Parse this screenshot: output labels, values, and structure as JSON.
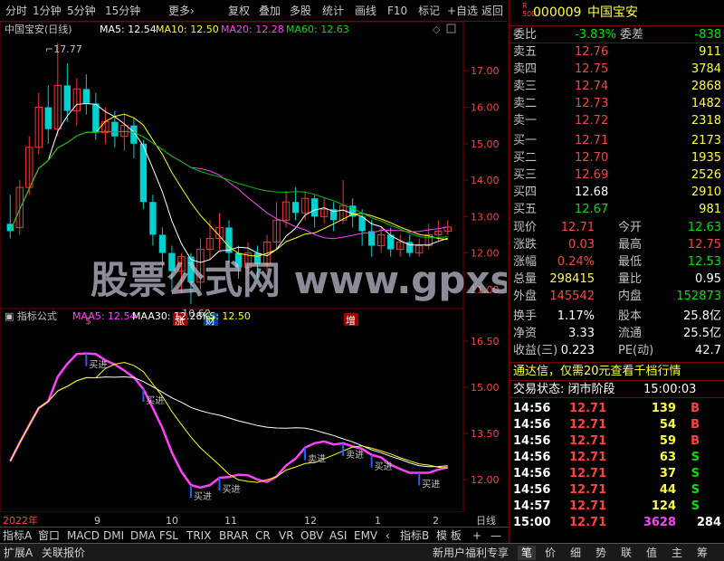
{
  "toolbar": {
    "left": [
      "分时",
      "1分钟",
      "5分钟",
      "15分钟",
      "更多›"
    ],
    "right": [
      "复权",
      "叠加",
      "多股",
      "统计",
      "画线",
      "F10",
      "标记",
      "+自选",
      "返回"
    ]
  },
  "chart_header": {
    "stock": "中国宝安(日线)",
    "ma5": "MA5: 12.54",
    "ma10": "MA10: 12.50",
    "ma20": "MA20: 12.28",
    "ma60": "MA60: 12.63"
  },
  "price_axis": [
    "17.00",
    "16.00",
    "15.00",
    "14.00",
    "13.00",
    "12.00",
    "11.00"
  ],
  "annotations": {
    "high": "17.77",
    "low": "10.60"
  },
  "event_marks": [
    "$",
    "涨",
    "财",
    "增"
  ],
  "watermark": "股票公式网 www.gpxs.com",
  "indicator": {
    "title": "指标公式",
    "maa5": "MAA5: 12.54",
    "maa30": "MAA30: 12.28",
    "ks": "KS: 12.50",
    "axis": [
      "16.50",
      "15.00",
      "13.50",
      "12.00"
    ],
    "buy_label": "买进",
    "sell_label": "卖进"
  },
  "dates": [
    "2022年",
    "9",
    "10",
    "11",
    "12",
    "1",
    "2"
  ],
  "period": "日线",
  "chart_data": {
    "type": "candlestick",
    "ylim": [
      10.5,
      17.9
    ],
    "ma_colors": {
      "ma5": "#ffffff",
      "ma10": "#ffff00",
      "ma20": "#ff40ff",
      "ma60": "#00c000"
    },
    "candles": [
      [
        12.8,
        12.6,
        13.6,
        12.4
      ],
      [
        12.7,
        13.8,
        14.0,
        12.5
      ],
      [
        13.8,
        14.9,
        15.2,
        13.6
      ],
      [
        14.9,
        16.0,
        16.4,
        14.7
      ],
      [
        16.0,
        15.4,
        16.6,
        15.0
      ],
      [
        15.4,
        16.6,
        17.77,
        15.2
      ],
      [
        16.6,
        15.9,
        17.2,
        15.6
      ],
      [
        15.9,
        16.5,
        16.8,
        15.5
      ],
      [
        16.5,
        16.1,
        16.9,
        15.8
      ],
      [
        16.1,
        15.3,
        16.4,
        15.1
      ],
      [
        15.3,
        15.6,
        16.0,
        15.0
      ],
      [
        15.6,
        15.2,
        15.9,
        14.9
      ],
      [
        15.2,
        15.5,
        15.8,
        14.8
      ],
      [
        15.5,
        15.0,
        15.7,
        14.6
      ],
      [
        15.0,
        13.4,
        15.1,
        13.2
      ],
      [
        13.4,
        12.5,
        13.6,
        12.2
      ],
      [
        12.5,
        12.0,
        12.7,
        11.6
      ],
      [
        12.0,
        11.5,
        12.2,
        11.0
      ],
      [
        11.5,
        11.9,
        12.0,
        10.9
      ],
      [
        11.9,
        11.2,
        12.0,
        10.6
      ],
      [
        11.2,
        12.1,
        12.4,
        11.0
      ],
      [
        12.1,
        12.4,
        12.9,
        11.8
      ],
      [
        12.4,
        12.7,
        13.1,
        12.1
      ],
      [
        12.7,
        12.0,
        12.9,
        11.7
      ],
      [
        12.0,
        11.6,
        12.2,
        11.3
      ],
      [
        11.6,
        12.0,
        12.3,
        11.4
      ],
      [
        12.0,
        11.7,
        12.2,
        11.3
      ],
      [
        11.7,
        12.3,
        12.5,
        11.5
      ],
      [
        12.3,
        12.9,
        13.4,
        12.1
      ],
      [
        12.9,
        13.4,
        13.7,
        12.7
      ],
      [
        13.4,
        13.1,
        13.8,
        12.9
      ],
      [
        13.1,
        13.5,
        13.7,
        12.9
      ],
      [
        13.5,
        13.0,
        13.6,
        12.7
      ],
      [
        13.0,
        13.2,
        13.5,
        12.8
      ],
      [
        13.2,
        12.9,
        13.4,
        12.6
      ],
      [
        12.9,
        13.3,
        14.0,
        12.8
      ],
      [
        13.3,
        13.0,
        13.5,
        12.7
      ],
      [
        13.0,
        12.6,
        13.2,
        12.2
      ],
      [
        12.6,
        12.2,
        12.9,
        11.9
      ],
      [
        12.2,
        12.5,
        12.7,
        12.0
      ],
      [
        12.5,
        12.1,
        12.7,
        11.9
      ],
      [
        12.1,
        12.3,
        12.5,
        11.9
      ],
      [
        12.3,
        12.0,
        12.5,
        11.9
      ],
      [
        12.0,
        12.2,
        12.4,
        11.9
      ],
      [
        12.2,
        12.5,
        12.8,
        12.1
      ],
      [
        12.5,
        12.6,
        12.9,
        12.3
      ],
      [
        12.6,
        12.71,
        12.9,
        12.5
      ]
    ]
  },
  "quote": {
    "code_badge": "R\n500",
    "code": "000009",
    "name": "中国宝安",
    "weibi_label": "委比",
    "weibi": "-3.83%",
    "weicha_label": "委差",
    "weicha": "-838",
    "asks": [
      {
        "label": "卖五",
        "price": "12.76",
        "vol": "911"
      },
      {
        "label": "卖四",
        "price": "12.75",
        "vol": "3784"
      },
      {
        "label": "卖三",
        "price": "12.74",
        "vol": "2868"
      },
      {
        "label": "卖二",
        "price": "12.73",
        "vol": "1482"
      },
      {
        "label": "卖一",
        "price": "12.72",
        "vol": "2318"
      }
    ],
    "bids": [
      {
        "label": "买一",
        "price": "12.71",
        "vol": "2173"
      },
      {
        "label": "买二",
        "price": "12.70",
        "vol": "1935"
      },
      {
        "label": "买三",
        "price": "12.69",
        "vol": "2526"
      },
      {
        "label": "买四",
        "price": "12.68",
        "vol": "2910"
      },
      {
        "label": "买五",
        "price": "12.67",
        "vol": "981"
      }
    ],
    "stats": [
      {
        "l1": "现价",
        "v1": "12.71",
        "l2": "今开",
        "v2": "12.63"
      },
      {
        "l1": "涨跌",
        "v1": "0.03",
        "l2": "最高",
        "v2": "12.75"
      },
      {
        "l1": "涨幅",
        "v1": "0.24%",
        "l2": "最低",
        "v2": "12.53"
      },
      {
        "l1": "总量",
        "v1": "298415",
        "l2": "量比",
        "v2": "0.95"
      },
      {
        "l1": "外盘",
        "v1": "145542",
        "l2": "内盘",
        "v2": "152873"
      }
    ],
    "stats2": [
      {
        "l1": "换手",
        "v1": "1.17%",
        "l2": "股本",
        "v2": "25.8亿"
      },
      {
        "l1": "净资",
        "v1": "3.33",
        "l2": "流通",
        "v2": "25.5亿"
      },
      {
        "l1": "收益(三)",
        "v1": "0.223",
        "l2": "PE(动)",
        "v2": "42.7"
      }
    ],
    "promo": "通达信，仅需20元查看千档行情",
    "trade_status_label": "交易状态: 闭市阶段",
    "trade_status_time": "15:00:03",
    "ticks": [
      {
        "t": "14:56",
        "p": "12.71",
        "v": "139",
        "s": "B"
      },
      {
        "t": "14:56",
        "p": "12.71",
        "v": "54",
        "s": "B"
      },
      {
        "t": "14:56",
        "p": "12.71",
        "v": "59",
        "s": "B"
      },
      {
        "t": "14:56",
        "p": "12.71",
        "v": "63",
        "s": "S"
      },
      {
        "t": "14:56",
        "p": "12.71",
        "v": "37",
        "s": "S"
      },
      {
        "t": "14:56",
        "p": "12.71",
        "v": "44",
        "s": "S"
      },
      {
        "t": "14:57",
        "p": "12.71",
        "v": "124",
        "s": "S"
      },
      {
        "t": "15:00",
        "p": "12.71",
        "v": "3628",
        "s": "284"
      }
    ]
  },
  "bottom_tabs": [
    "指标A",
    "窗口",
    "MACD",
    "DMI",
    "DMA",
    "FSL",
    "TRIX",
    "BRAR",
    "CR",
    "VR",
    "OBV",
    "ASI",
    "EMV",
    "‹",
    "指标B",
    "模 板",
    "+",
    "—"
  ],
  "status_left": [
    "扩展A",
    "关联报价"
  ],
  "status_promo": "新用户福利专享",
  "status_right": [
    "笔",
    "价",
    "细",
    "势",
    "联",
    "值",
    "主",
    "筹"
  ]
}
